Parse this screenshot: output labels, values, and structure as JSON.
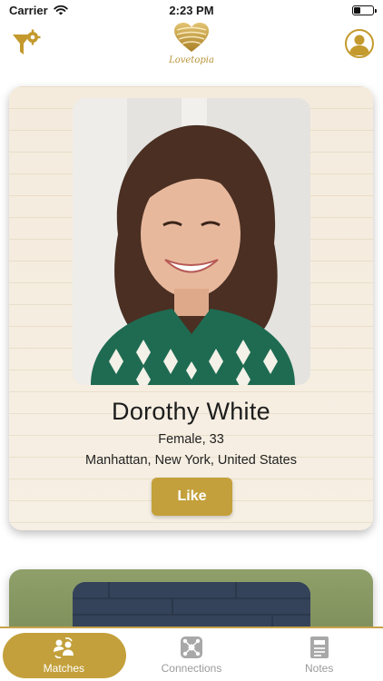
{
  "status_bar": {
    "carrier": "Carrier",
    "time": "2:23 PM",
    "battery_level": 0.35
  },
  "header": {
    "logo_text": "Lovetopia",
    "filter_icon": "filter-gear-icon",
    "profile_icon": "user-profile-icon"
  },
  "cards": [
    {
      "name": "Dorothy White",
      "meta": "Female, 33",
      "location": "Manhattan, New York, United States",
      "like_label": "Like"
    }
  ],
  "tabs": [
    {
      "label": "Matches",
      "icon": "matches-icon",
      "active": true
    },
    {
      "label": "Connections",
      "icon": "connections-icon",
      "active": false
    },
    {
      "label": "Notes",
      "icon": "notes-icon",
      "active": false
    }
  ],
  "colors": {
    "accent": "#c3a03b",
    "accent_border": "#c8a24a",
    "inactive_tab": "#9a9a9a"
  }
}
